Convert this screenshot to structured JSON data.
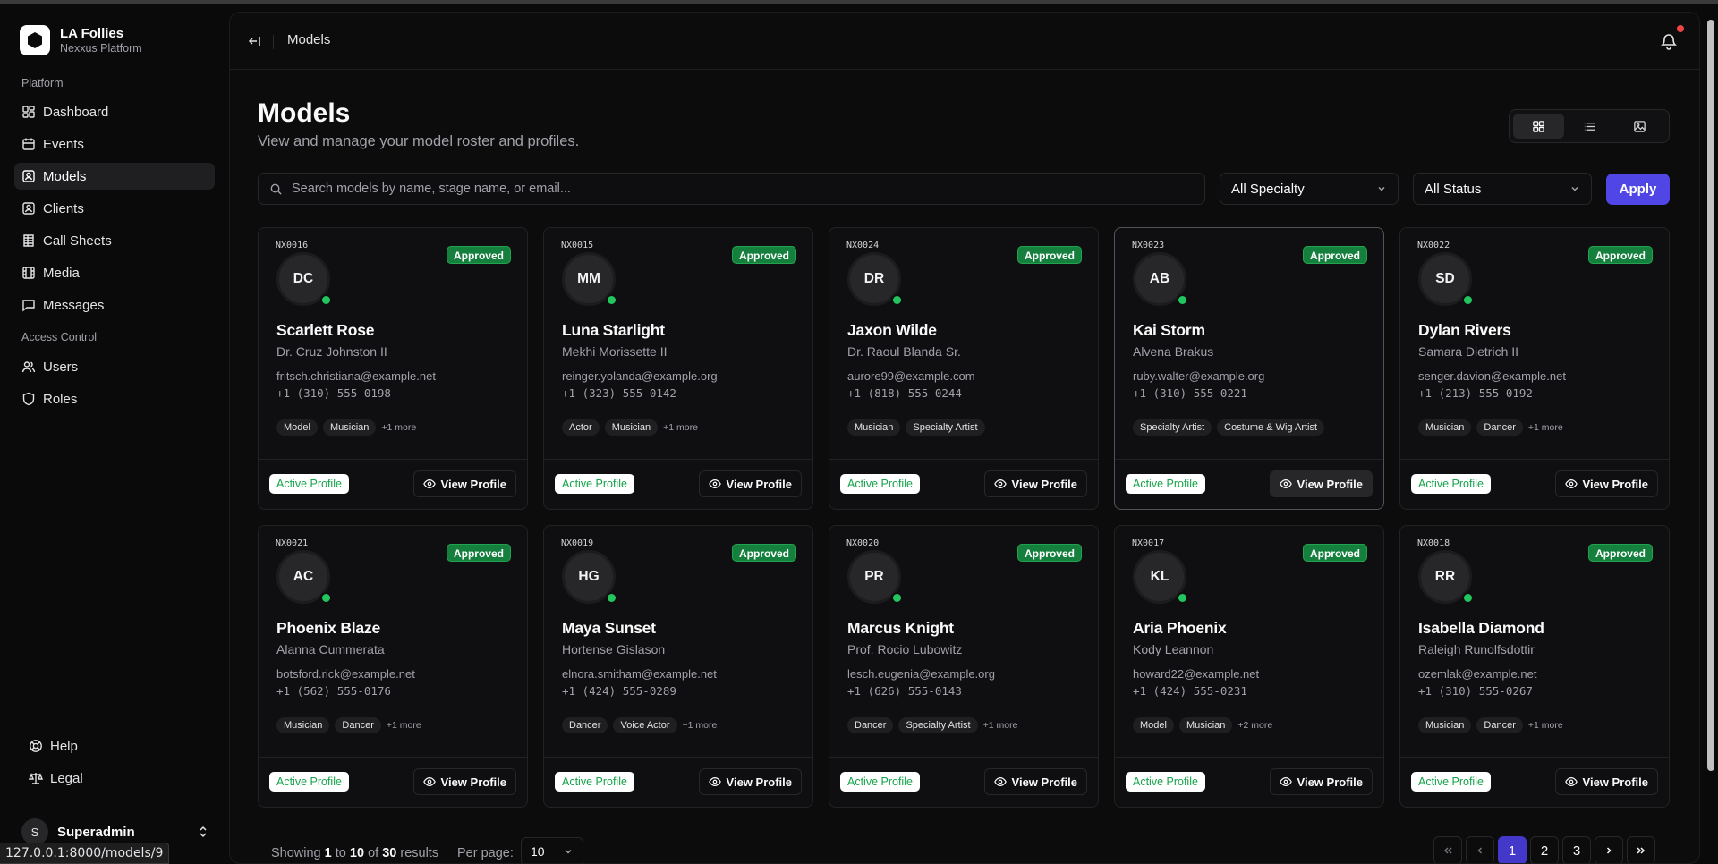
{
  "brand": {
    "title": "LA Follies",
    "subtitle": "Nexxus Platform"
  },
  "sidebar": {
    "platform_label": "Platform",
    "platform_items": [
      {
        "label": "Dashboard",
        "icon": "dashboard-icon"
      },
      {
        "label": "Events",
        "icon": "events-icon"
      },
      {
        "label": "Models",
        "icon": "models-icon",
        "active": true
      },
      {
        "label": "Clients",
        "icon": "clients-icon"
      },
      {
        "label": "Call Sheets",
        "icon": "call-sheets-icon"
      },
      {
        "label": "Media",
        "icon": "media-icon"
      },
      {
        "label": "Messages",
        "icon": "messages-icon"
      }
    ],
    "access_label": "Access Control",
    "access_items": [
      {
        "label": "Users",
        "icon": "users-icon"
      },
      {
        "label": "Roles",
        "icon": "roles-icon"
      }
    ],
    "bottom_items": [
      {
        "label": "Help",
        "icon": "help-icon"
      },
      {
        "label": "Legal",
        "icon": "legal-icon"
      }
    ],
    "user": {
      "initial": "S",
      "name": "Superadmin"
    }
  },
  "status_url": "127.0.0.1:8000/models/9",
  "header": {
    "breadcrumb": "Models"
  },
  "page": {
    "title": "Models",
    "subtitle": "View and manage your model roster and profiles."
  },
  "filters": {
    "search_placeholder": "Search models by name, stage name, or email...",
    "specialty": "All Specialty",
    "status": "All Status",
    "apply_label": "Apply"
  },
  "cards": [
    {
      "code": "NX0016",
      "initials": "DC",
      "badge": "Approved",
      "name": "Scarlett Rose",
      "stage": "Dr. Cruz Johnston II",
      "email": "fritsch.christiana@example.net",
      "phone": "+1 (310) 555-0198",
      "tags": [
        "Model",
        "Musician"
      ],
      "more": "+1 more",
      "active": "Active Profile",
      "view": "View Profile"
    },
    {
      "code": "NX0015",
      "initials": "MM",
      "badge": "Approved",
      "name": "Luna Starlight",
      "stage": "Mekhi Morissette II",
      "email": "reinger.yolanda@example.org",
      "phone": "+1 (323) 555-0142",
      "tags": [
        "Actor",
        "Musician"
      ],
      "more": "+1 more",
      "active": "Active Profile",
      "view": "View Profile"
    },
    {
      "code": "NX0024",
      "initials": "DR",
      "badge": "Approved",
      "name": "Jaxon Wilde",
      "stage": "Dr. Raoul Blanda Sr.",
      "email": "aurore99@example.com",
      "phone": "+1 (818) 555-0244",
      "tags": [
        "Musician",
        "Specialty Artist"
      ],
      "more": "",
      "active": "Active Profile",
      "view": "View Profile"
    },
    {
      "code": "NX0023",
      "initials": "AB",
      "badge": "Approved",
      "name": "Kai Storm",
      "stage": "Alvena Brakus",
      "email": "ruby.walter@example.org",
      "phone": "+1 (310) 555-0221",
      "tags": [
        "Specialty Artist",
        "Costume & Wig Artist"
      ],
      "more": "",
      "active": "Active Profile",
      "view": "View Profile",
      "highlight": true
    },
    {
      "code": "NX0022",
      "initials": "SD",
      "badge": "Approved",
      "name": "Dylan Rivers",
      "stage": "Samara Dietrich II",
      "email": "senger.davion@example.net",
      "phone": "+1 (213) 555-0192",
      "tags": [
        "Musician",
        "Dancer"
      ],
      "more": "+1 more",
      "active": "Active Profile",
      "view": "View Profile"
    },
    {
      "code": "NX0021",
      "initials": "AC",
      "badge": "Approved",
      "name": "Phoenix Blaze",
      "stage": "Alanna Cummerata",
      "email": "botsford.rick@example.net",
      "phone": "+1 (562) 555-0176",
      "tags": [
        "Musician",
        "Dancer"
      ],
      "more": "+1 more",
      "active": "Active Profile",
      "view": "View Profile"
    },
    {
      "code": "NX0019",
      "initials": "HG",
      "badge": "Approved",
      "name": "Maya Sunset",
      "stage": "Hortense Gislason",
      "email": "elnora.smitham@example.net",
      "phone": "+1 (424) 555-0289",
      "tags": [
        "Dancer",
        "Voice Actor"
      ],
      "more": "+1 more",
      "active": "Active Profile",
      "view": "View Profile"
    },
    {
      "code": "NX0020",
      "initials": "PR",
      "badge": "Approved",
      "name": "Marcus Knight",
      "stage": "Prof. Rocio Lubowitz",
      "email": "lesch.eugenia@example.org",
      "phone": "+1 (626) 555-0143",
      "tags": [
        "Dancer",
        "Specialty Artist"
      ],
      "more": "+1 more",
      "active": "Active Profile",
      "view": "View Profile"
    },
    {
      "code": "NX0017",
      "initials": "KL",
      "badge": "Approved",
      "name": "Aria Phoenix",
      "stage": "Kody Leannon",
      "email": "howard22@example.net",
      "phone": "+1 (424) 555-0231",
      "tags": [
        "Model",
        "Musician"
      ],
      "more": "+2 more",
      "active": "Active Profile",
      "view": "View Profile"
    },
    {
      "code": "NX0018",
      "initials": "RR",
      "badge": "Approved",
      "name": "Isabella Diamond",
      "stage": "Raleigh Runolfsdottir",
      "email": "ozemlak@example.net",
      "phone": "+1 (310) 555-0267",
      "tags": [
        "Musician",
        "Dancer"
      ],
      "more": "+1 more",
      "active": "Active Profile",
      "view": "View Profile"
    }
  ],
  "pagination": {
    "showing_prefix": "Showing",
    "from": "1",
    "to_word": "to",
    "to": "10",
    "of_word": "of",
    "total": "30",
    "results_word": "results",
    "per_page_label": "Per page:",
    "per_page": "10",
    "pages": [
      "1",
      "2",
      "3"
    ],
    "current_page": "1"
  },
  "colors": {
    "accent": "#4f46e5",
    "approved": "#15803d",
    "online": "#22c55e",
    "notification": "#ef4444"
  }
}
